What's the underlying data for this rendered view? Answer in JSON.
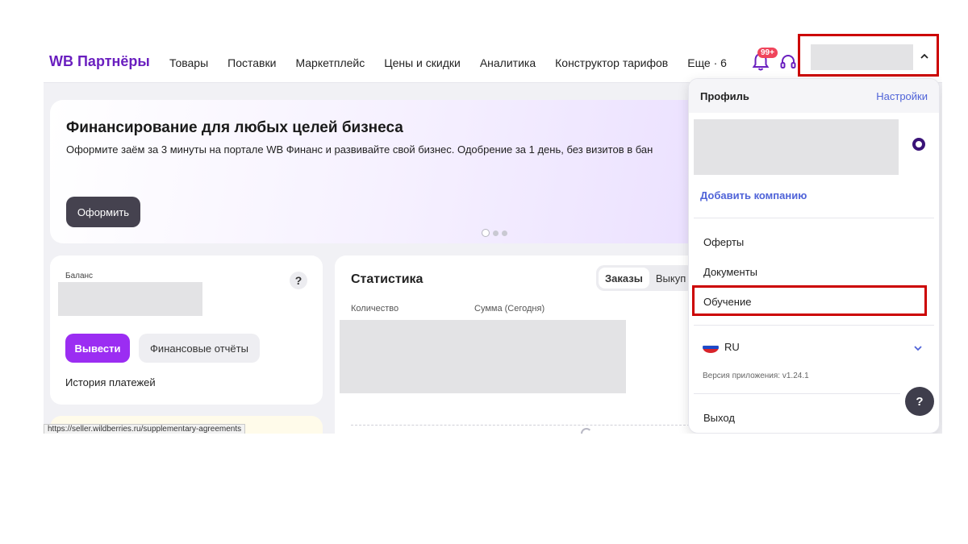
{
  "header": {
    "logo": "WB Партнёры",
    "nav": [
      "Товары",
      "Поставки",
      "Маркетплейс",
      "Цены и скидки",
      "Аналитика",
      "Конструктор тарифов",
      "Еще · 6"
    ],
    "notifications_badge": "99+"
  },
  "banner": {
    "title": "Финансирование для любых целей бизнеса",
    "text": "Оформите заём за 3 минуты на портале WB Финанс и развивайте свой бизнес. Одобрение за 1 день, без визитов в бан",
    "button": "Оформить"
  },
  "balance": {
    "label": "Баланс",
    "help": "?",
    "withdraw_button": "Вывести",
    "reports_button": "Финансовые отчёты",
    "history_link": "История платежей"
  },
  "statistics": {
    "title": "Статистика",
    "tabs": [
      "Заказы",
      "Выкуп"
    ],
    "active_tab": "Заказы",
    "columns": [
      "Количество",
      "Сумма (Сегодня)"
    ]
  },
  "status_bar_url": "https://seller.wildberries.ru/supplementary-agreements",
  "profile_dropdown": {
    "title": "Профиль",
    "settings_link": "Настройки",
    "add_company": "Добавить компанию",
    "menu_items": [
      "Оферты",
      "Документы",
      "Обучение"
    ],
    "language": "RU",
    "version": "Версия приложения: v1.24.1",
    "logout": "Выход",
    "help": "?"
  },
  "colors": {
    "brand": "#6a1fbf",
    "primary_button": "#9b2df2",
    "link": "#4f63d8",
    "badge": "#f0445b",
    "highlight_box": "#cc0000"
  }
}
